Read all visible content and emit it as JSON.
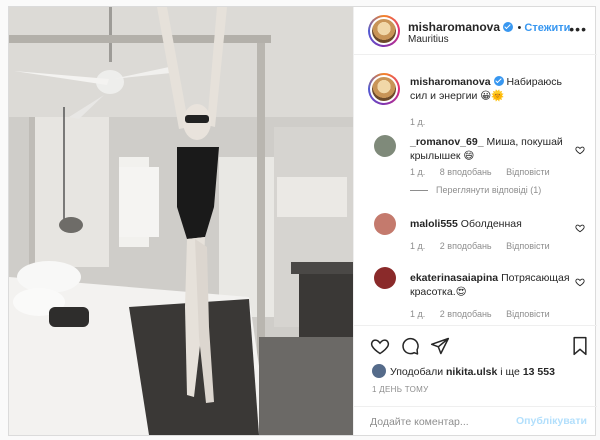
{
  "header": {
    "username": "misharomanova",
    "follow_label": "Стежити",
    "location": "Mauritius",
    "more_icon": "more-horizontal-icon"
  },
  "caption": {
    "username": "misharomanova",
    "text": "Набираюсь сил и энергии 😀🌞",
    "age": "1 д."
  },
  "comments": [
    {
      "username": "_romanov_69_",
      "text": "Миша, покушай крылышек 😄",
      "age": "1 д.",
      "likes": "8 вподобань",
      "reply": "Відповісти",
      "view_replies": "Переглянути відповіді (1)",
      "avatar_color": "#7f8a7a"
    },
    {
      "username": "maloli555",
      "text": "Оболденная",
      "age": "1 д.",
      "likes": "2 вподобань",
      "reply": "Відповісти",
      "avatar_color": "#c47a6d"
    },
    {
      "username": "ekaterinasaiapina",
      "text": "Потрясающая красотка.😍",
      "age": "1 д.",
      "likes": "2 вподобань",
      "reply": "Відповісти",
      "avatar_color": "#8a2a2a"
    }
  ],
  "actions": {
    "icons": [
      "heart-icon",
      "comment-icon",
      "share-icon",
      "bookmark-icon"
    ],
    "liked_by_prefix": "Уподобали",
    "liked_by_user": "nikita.ulsk",
    "liked_by_suffix": " і ще ",
    "liked_count": "13 553",
    "posted_time": "1 ДЕНЬ ТОМУ"
  },
  "add_comment": {
    "placeholder": "Додайте коментар...",
    "post_label": "Опублікувати"
  },
  "colors": {
    "link_blue": "#3897f0",
    "post_disabled": "#b2dffc",
    "muted": "#8e8e8e",
    "border": "#dbdbdb"
  }
}
